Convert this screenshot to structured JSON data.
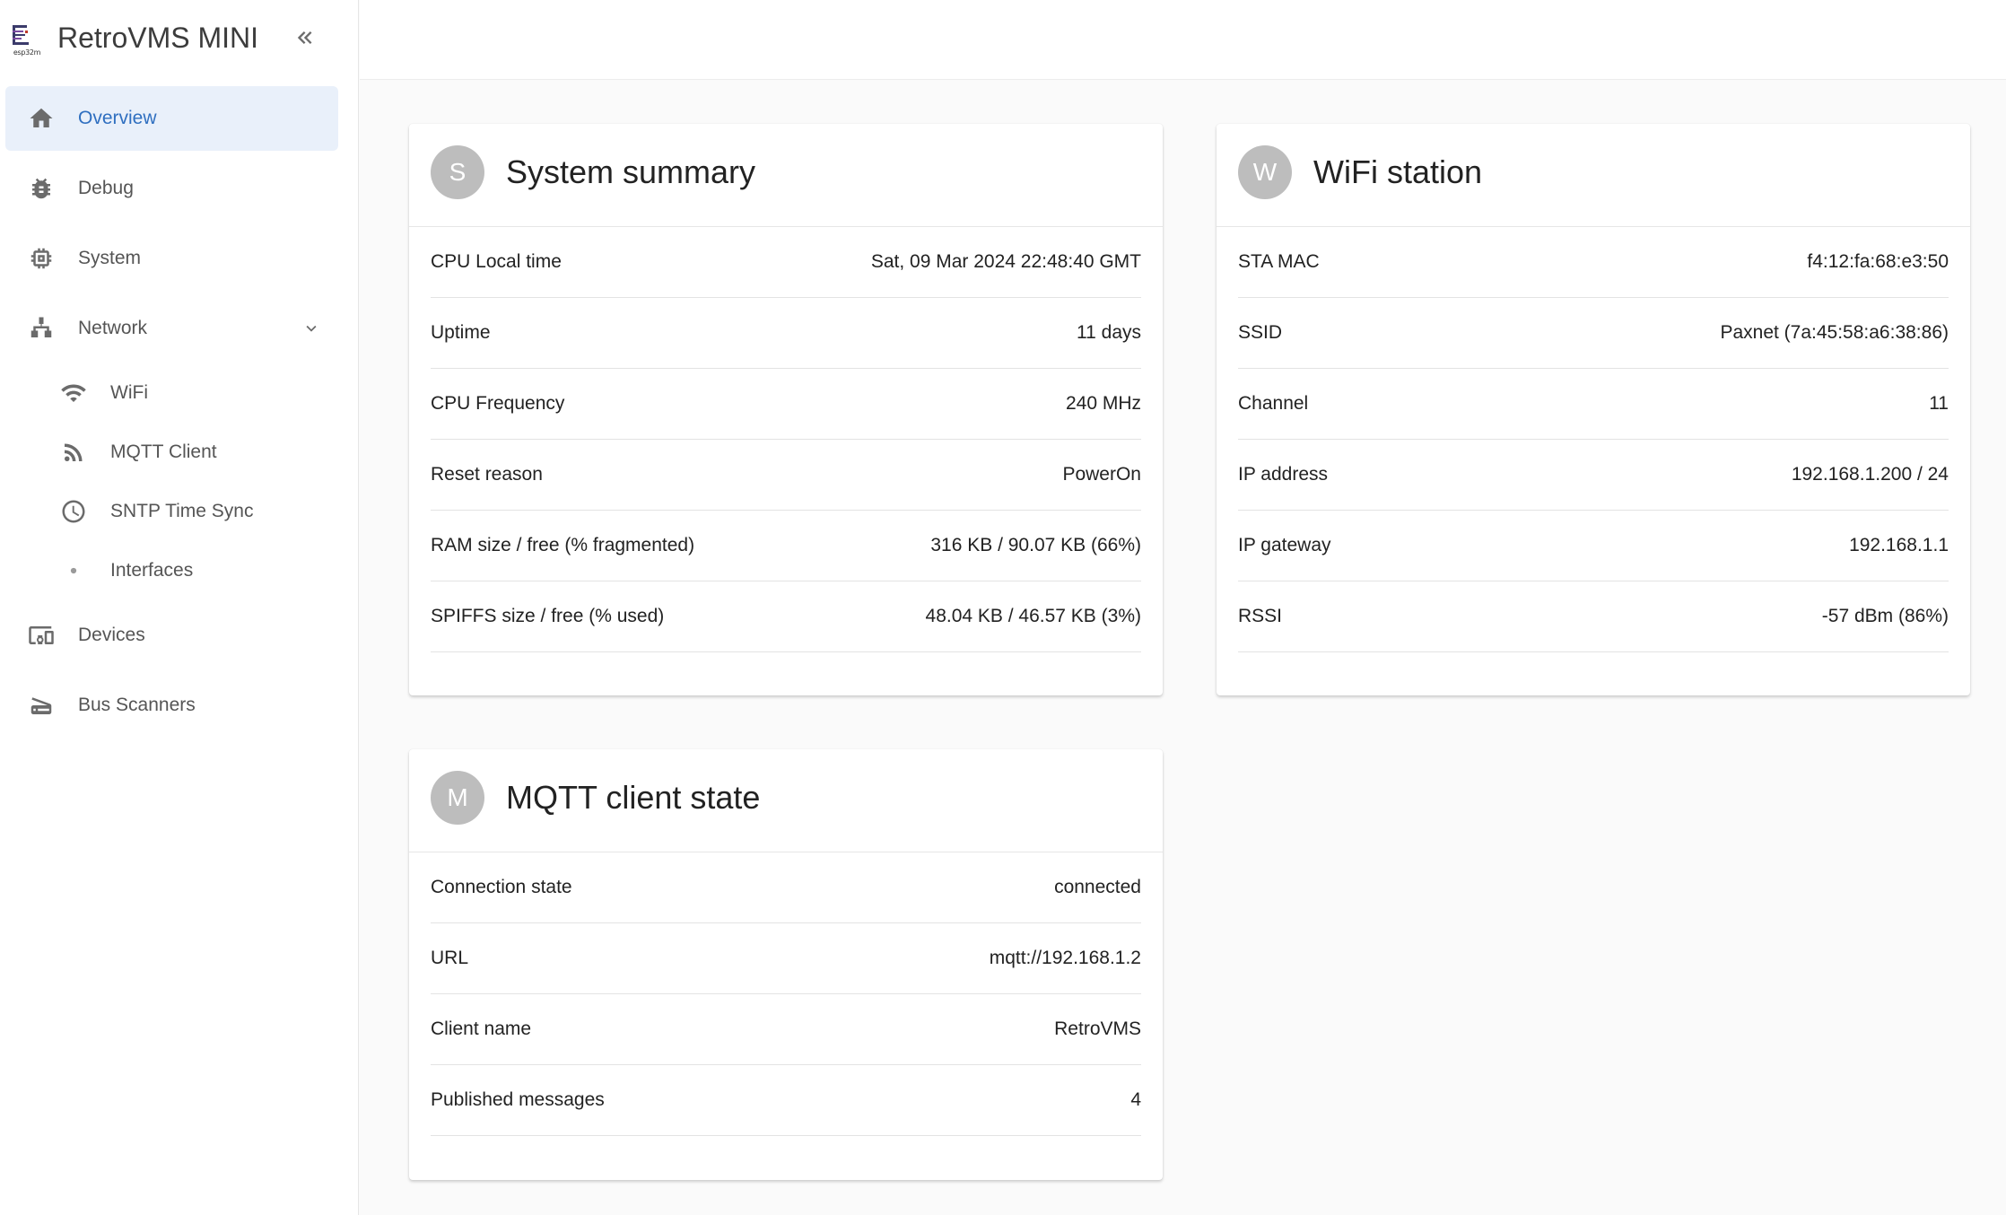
{
  "app": {
    "title": "RetroVMS MINI",
    "logo_text": "esp32m"
  },
  "sidebar": {
    "items": [
      {
        "label": "Overview",
        "icon": "home-icon"
      },
      {
        "label": "Debug",
        "icon": "bug-icon"
      },
      {
        "label": "System",
        "icon": "cpu-icon"
      },
      {
        "label": "Network",
        "icon": "network-icon"
      },
      {
        "label": "Devices",
        "icon": "devices-icon"
      },
      {
        "label": "Bus Scanners",
        "icon": "scanner-icon"
      }
    ],
    "network_children": [
      {
        "label": "WiFi",
        "icon": "wifi-icon"
      },
      {
        "label": "MQTT Client",
        "icon": "rss-icon"
      },
      {
        "label": "SNTP Time Sync",
        "icon": "clock-icon"
      },
      {
        "label": "Interfaces",
        "icon": "dot-icon"
      }
    ]
  },
  "cards": {
    "system": {
      "avatar": "S",
      "title": "System summary",
      "rows": [
        {
          "k": "CPU Local time",
          "v": "Sat, 09 Mar 2024 22:48:40 GMT"
        },
        {
          "k": "Uptime",
          "v": "11 days"
        },
        {
          "k": "CPU Frequency",
          "v": "240 MHz"
        },
        {
          "k": "Reset reason",
          "v": "PowerOn"
        },
        {
          "k": "RAM size / free (% fragmented)",
          "v": "316 KB / 90.07 KB (66%)"
        },
        {
          "k": "SPIFFS size / free (% used)",
          "v": "48.04 KB / 46.57 KB (3%)"
        }
      ]
    },
    "wifi": {
      "avatar": "W",
      "title": "WiFi station",
      "rows": [
        {
          "k": "STA MAC",
          "v": "f4:12:fa:68:e3:50"
        },
        {
          "k": "SSID",
          "v": "Paxnet (7a:45:58:a6:38:86)"
        },
        {
          "k": "Channel",
          "v": "11"
        },
        {
          "k": "IP address",
          "v": "192.168.1.200 / 24"
        },
        {
          "k": "IP gateway",
          "v": "192.168.1.1"
        },
        {
          "k": "RSSI",
          "v": "-57 dBm (86%)"
        }
      ]
    },
    "mqtt": {
      "avatar": "M",
      "title": "MQTT client state",
      "rows": [
        {
          "k": "Connection state",
          "v": "connected"
        },
        {
          "k": "URL",
          "v": "mqtt://192.168.1.2"
        },
        {
          "k": "Client name",
          "v": "RetroVMS"
        },
        {
          "k": "Published messages",
          "v": "4"
        }
      ]
    }
  },
  "colors": {
    "accent": "#2f6fc0",
    "active_bg": "#e9f0fa",
    "avatar_bg": "#bdbdbd",
    "icon": "#6b6b6b"
  }
}
